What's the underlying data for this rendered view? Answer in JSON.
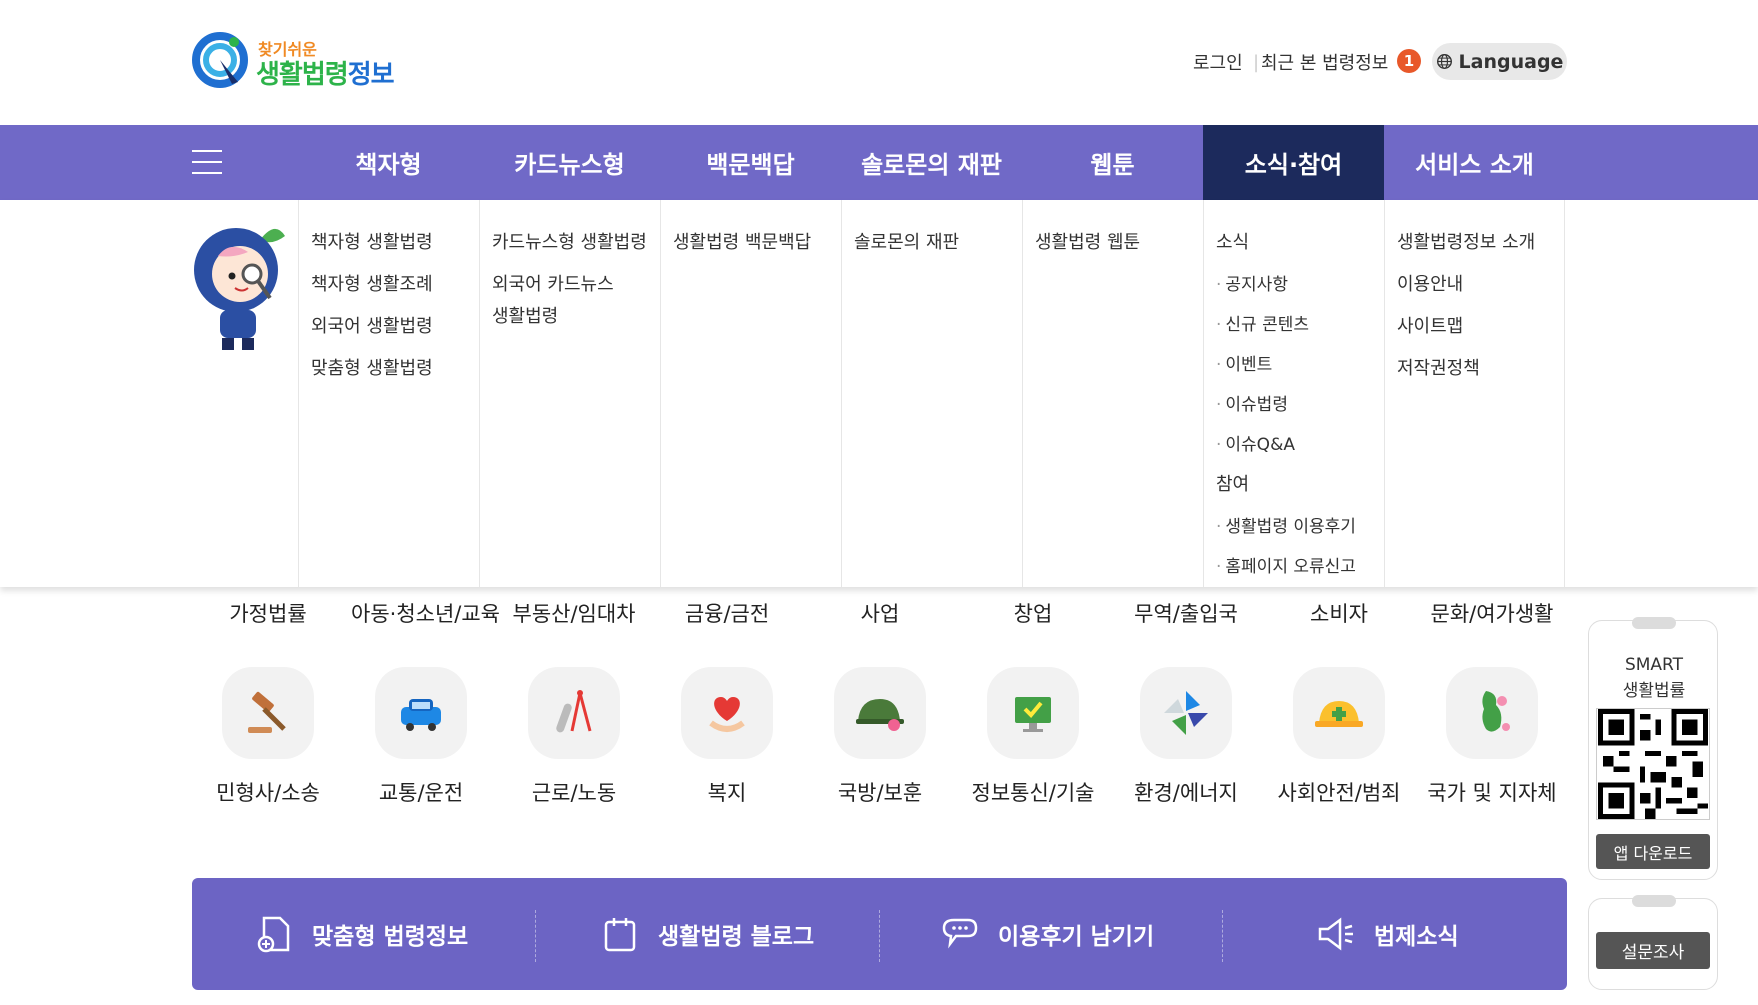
{
  "header": {
    "logo_sub": "찾기쉬운",
    "logo_main_1": "생활법령",
    "logo_main_2": "정보",
    "login": "로그인",
    "recent": "최근 본 법령정보",
    "recent_count": "1",
    "language": "Language"
  },
  "nav": {
    "items": [
      "책자형",
      "카드뉴스형",
      "백문백답",
      "솔로몬의 재판",
      "웹툰",
      "소식·참여",
      "서비스 소개"
    ],
    "active_index": 5,
    "menu_icon": "hamburger-icon"
  },
  "mega": {
    "col1": [
      "책자형 생활법령",
      "책자형 생활조례",
      "외국어 생활법령",
      "맞춤형 생활법령"
    ],
    "col2": [
      "카드뉴스형 생활법령",
      "외국어 카드뉴스",
      "생활법령"
    ],
    "col3": [
      "생활법령 백문백답"
    ],
    "col4": [
      "솔로몬의 재판"
    ],
    "col5": [
      "생활법령 웹툰"
    ],
    "col6": {
      "heading1": "소식",
      "subs1": [
        "공지사항",
        "신규 콘텐츠",
        "이벤트",
        "이슈법령",
        "이슈Q&A"
      ],
      "heading2": "참여",
      "subs2": [
        "생활법령 이용후기",
        "홈페이지 오류신고"
      ]
    },
    "col7": [
      "생활법령정보 소개",
      "이용안내",
      "사이트맵",
      "저작권정책"
    ]
  },
  "categories": {
    "row1": [
      "가정법률",
      "아동·청소년/교육",
      "부동산/임대차",
      "금융/금전",
      "사업",
      "창업",
      "무역/출입국",
      "소비자",
      "문화/여가생활"
    ],
    "row2": [
      "민형사/소송",
      "교통/운전",
      "근로/노동",
      "복지",
      "국방/보훈",
      "정보통신/기술",
      "환경/에너지",
      "사회안전/범죄",
      "국가 및 지자체"
    ],
    "row2_icons": [
      "gavel-icon",
      "car-icon",
      "compass-icon",
      "heart-hand-icon",
      "helmet-icon",
      "monitor-check-icon",
      "pinwheel-icon",
      "safety-helmet-icon",
      "korea-map-icon"
    ]
  },
  "side": {
    "smart_1": "SMART",
    "smart_2": "생활법률",
    "app_download": "앱 다운로드",
    "survey": "설문조사"
  },
  "bottom": {
    "items": [
      "맞춤형 법령정보",
      "생활법령 블로그",
      "이용후기 남기기",
      "법제소식"
    ]
  },
  "colors": {
    "nav_bg": "#7069c7",
    "nav_active": "#1c2a5c",
    "bottom_bg": "#6c64c4",
    "badge": "#e8582a"
  }
}
